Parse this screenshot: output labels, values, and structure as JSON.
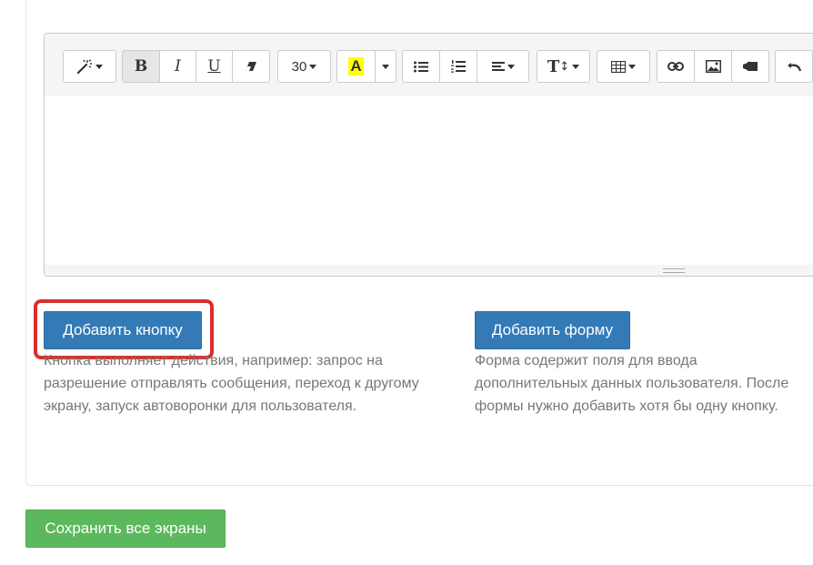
{
  "editor": {
    "toolbar": {
      "font_size": "30",
      "highlight_letter": "A",
      "bold": "B",
      "italic": "I",
      "underline": "U",
      "text_height_glyph": "T",
      "highlight_color": "#ffff00"
    }
  },
  "actions": {
    "add_button": {
      "label": "Добавить кнопку",
      "description": "Кнопка выполняет действия, например: запрос на разрешение отправлять сообщения, переход к другому экрану, запуск автоворонки для пользователя."
    },
    "add_form": {
      "label": "Добавить форму",
      "description": "Форма содержит поля для ввода дополнительных данных пользователя. После формы нужно добавить хотя бы одну кнопку."
    }
  },
  "footer": {
    "save_all_label": "Сохранить все экраны"
  },
  "colors": {
    "primary": "#337ab7",
    "success": "#5cb85c",
    "highlight_frame": "#d9302c"
  },
  "icons": [
    "magic-wand-icon",
    "eraser-icon",
    "bullet-list-icon",
    "numbered-list-icon",
    "align-icon",
    "text-height-icon",
    "table-icon",
    "link-icon",
    "image-icon",
    "video-icon",
    "undo-icon"
  ]
}
